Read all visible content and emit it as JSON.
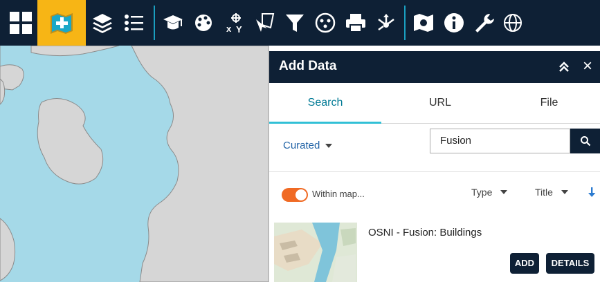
{
  "colors": {
    "toolbar_bg": "#0e2035",
    "active_tool": "#f7b515",
    "accent_teal": "#31c0d6",
    "toggle_on": "#f06a24",
    "water": "#a5d9e8",
    "land": "#d6d6d6"
  },
  "toolbar": {
    "tools": [
      {
        "icon": "grid-icon"
      },
      {
        "icon": "add-data-icon",
        "active": true
      },
      {
        "icon": "layers-icon"
      },
      {
        "icon": "legend-list-icon"
      },
      {
        "icon": "mortarboard-icon"
      },
      {
        "icon": "palette-icon"
      },
      {
        "icon": "xy-coordinates-icon"
      },
      {
        "icon": "select-features-icon"
      },
      {
        "icon": "filter-icon"
      },
      {
        "icon": "analysis-icon"
      },
      {
        "icon": "print-icon"
      },
      {
        "icon": "share-icon"
      },
      {
        "icon": "basemap-icon"
      },
      {
        "icon": "info-icon"
      },
      {
        "icon": "wrench-icon"
      },
      {
        "icon": "globe-icon"
      }
    ]
  },
  "panel": {
    "title": "Add Data",
    "collapse_icon": "double-chevron-up-icon",
    "close_label": "×",
    "tabs": [
      {
        "label": "Search",
        "active": true
      },
      {
        "label": "URL"
      },
      {
        "label": "File"
      }
    ],
    "scope_label": "Curated",
    "search": {
      "value": "Fusion"
    },
    "within_map": {
      "label": "Within map...",
      "on": true
    },
    "sort": {
      "type_label": "Type",
      "title_label": "Title",
      "direction": "descending"
    },
    "results": [
      {
        "title": "OSNI - Fusion: Buildings",
        "add_label": "ADD",
        "details_label": "DETAILS"
      }
    ]
  }
}
